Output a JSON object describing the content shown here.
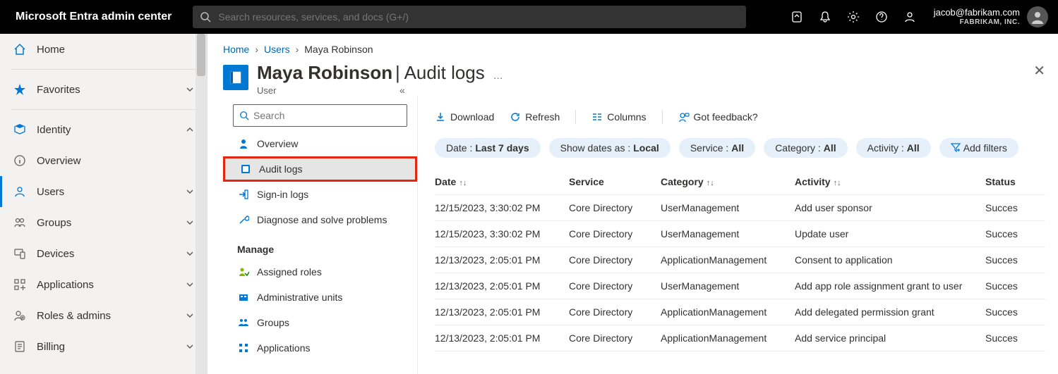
{
  "header": {
    "brand": "Microsoft Entra admin center",
    "search_placeholder": "Search resources, services, and docs (G+/)",
    "user_email": "jacob@fabrikam.com",
    "tenant": "FABRIKAM, INC."
  },
  "leftnav": {
    "home": "Home",
    "favorites": "Favorites",
    "identity": "Identity",
    "overview": "Overview",
    "users": "Users",
    "groups": "Groups",
    "devices": "Devices",
    "applications": "Applications",
    "roles_admins": "Roles & admins",
    "billing": "Billing"
  },
  "breadcrumb": {
    "home": "Home",
    "users": "Users",
    "current": "Maya Robinson"
  },
  "title": {
    "name": "Maya Robinson",
    "section": "Audit logs",
    "subtitle": "User"
  },
  "subnav": {
    "search_placeholder": "Search",
    "overview": "Overview",
    "audit_logs": "Audit logs",
    "sign_in_logs": "Sign-in logs",
    "diagnose": "Diagnose and solve problems",
    "manage_header": "Manage",
    "assigned_roles": "Assigned roles",
    "admin_units": "Administrative units",
    "groups": "Groups",
    "applications": "Applications"
  },
  "toolbar": {
    "download": "Download",
    "refresh": "Refresh",
    "columns": "Columns",
    "feedback": "Got feedback?"
  },
  "filters": {
    "date_label": "Date : ",
    "date_value": "Last 7 days",
    "show_dates_label": "Show dates as : ",
    "show_dates_value": "Local",
    "service_label": "Service : ",
    "service_value": "All",
    "category_label": "Category : ",
    "category_value": "All",
    "activity_label": "Activity : ",
    "activity_value": "All",
    "add_filters": "Add filters"
  },
  "table": {
    "headers": {
      "date": "Date",
      "service": "Service",
      "category": "Category",
      "activity": "Activity",
      "status": "Status"
    },
    "rows": [
      {
        "date": "12/15/2023, 3:30:02 PM",
        "service": "Core Directory",
        "category": "UserManagement",
        "activity": "Add user sponsor",
        "status": "Succes"
      },
      {
        "date": "12/15/2023, 3:30:02 PM",
        "service": "Core Directory",
        "category": "UserManagement",
        "activity": "Update user",
        "status": "Succes"
      },
      {
        "date": "12/13/2023, 2:05:01 PM",
        "service": "Core Directory",
        "category": "ApplicationManagement",
        "activity": "Consent to application",
        "status": "Succes"
      },
      {
        "date": "12/13/2023, 2:05:01 PM",
        "service": "Core Directory",
        "category": "UserManagement",
        "activity": "Add app role assignment grant to user",
        "status": "Succes"
      },
      {
        "date": "12/13/2023, 2:05:01 PM",
        "service": "Core Directory",
        "category": "ApplicationManagement",
        "activity": "Add delegated permission grant",
        "status": "Succes"
      },
      {
        "date": "12/13/2023, 2:05:01 PM",
        "service": "Core Directory",
        "category": "ApplicationManagement",
        "activity": "Add service principal",
        "status": "Succes"
      }
    ]
  }
}
